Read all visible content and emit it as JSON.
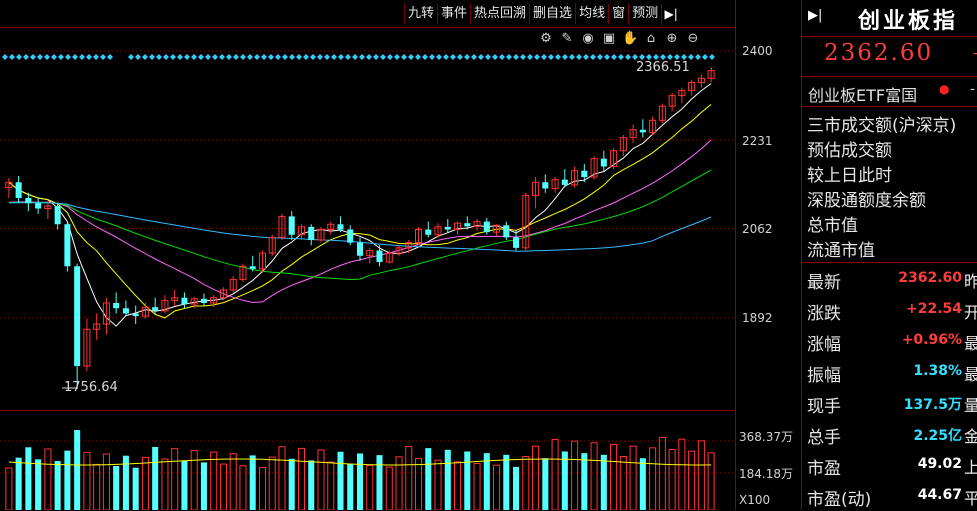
{
  "toolbar": {
    "buttons": [
      "九转",
      "事件",
      "热点回溯",
      "删自选",
      "均线",
      "窗",
      "预测"
    ],
    "collapse_icon": "collapse-arrow-icon"
  },
  "tools": [
    "gear-icon",
    "pen-icon",
    "eye-icon",
    "bag-icon",
    "hand-icon",
    "lock-icon",
    "zoom-in-icon",
    "zoom-out-icon"
  ],
  "axis": {
    "price_ticks": [
      "2400",
      "2231",
      "2062",
      "1892"
    ],
    "volume_ticks": [
      "368.37万",
      "184.18万"
    ],
    "volume_unit": "X100"
  },
  "annotations": {
    "high": "2366.51",
    "low": "1756.64"
  },
  "panel": {
    "title": "创业板指",
    "price": "2362.60",
    "price_sign": "+",
    "etf_label": "创业板ETF富国",
    "info_items": [
      "三市成交额(沪深京)",
      "预估成交额",
      "较上日此时",
      "深股通额度余额",
      "总市值",
      "流通市值"
    ],
    "rows": [
      {
        "label": "最新",
        "value": "2362.60",
        "tail": "昨",
        "color": "red"
      },
      {
        "label": "涨跌",
        "value": "+22.54",
        "tail": "开",
        "color": "red"
      },
      {
        "label": "涨幅",
        "value": "+0.96%",
        "tail": "最",
        "color": "red"
      },
      {
        "label": "振幅",
        "value": "1.38%",
        "tail": "最",
        "color": "cyan"
      },
      {
        "label": "现手",
        "value": "137.5万",
        "tail": "量",
        "color": "cyan"
      },
      {
        "label": "总手",
        "value": "2.25亿",
        "tail": "金",
        "color": "cyan"
      },
      {
        "label": "市盈",
        "value": "49.02",
        "tail": "上",
        "color": "white"
      },
      {
        "label": "市盈(动)",
        "value": "44.67",
        "tail": "平",
        "color": "white"
      }
    ]
  },
  "colors": {
    "up": "#ff3333",
    "down": "#54ffff",
    "ma5": "#ffffff",
    "ma10": "#ffff00",
    "ma20": "#ff66ff",
    "ma30": "#00dd00",
    "ma60": "#33bbff"
  },
  "chart_data": {
    "type": "candlestick",
    "price_range": [
      1720,
      2440
    ],
    "candles": [
      [
        2140,
        2158,
        2120,
        2150
      ],
      [
        2150,
        2162,
        2110,
        2120
      ],
      [
        2120,
        2130,
        2095,
        2110
      ],
      [
        2110,
        2120,
        2090,
        2100
      ],
      [
        2100,
        2115,
        2080,
        2105
      ],
      [
        2105,
        2110,
        2060,
        2070
      ],
      [
        2070,
        2075,
        1980,
        1990
      ],
      [
        1990,
        1995,
        1756.64,
        1800
      ],
      [
        1800,
        1890,
        1790,
        1870
      ],
      [
        1870,
        1900,
        1850,
        1880
      ],
      [
        1880,
        1930,
        1860,
        1920
      ],
      [
        1920,
        1940,
        1900,
        1910
      ],
      [
        1910,
        1925,
        1895,
        1900
      ],
      [
        1900,
        1915,
        1880,
        1895
      ],
      [
        1895,
        1920,
        1890,
        1912
      ],
      [
        1912,
        1930,
        1900,
        1905
      ],
      [
        1905,
        1935,
        1900,
        1925
      ],
      [
        1925,
        1945,
        1915,
        1930
      ],
      [
        1930,
        1940,
        1910,
        1918
      ],
      [
        1918,
        1932,
        1910,
        1928
      ],
      [
        1928,
        1938,
        1915,
        1920
      ],
      [
        1920,
        1935,
        1912,
        1930
      ],
      [
        1930,
        1950,
        1925,
        1945
      ],
      [
        1945,
        1972,
        1940,
        1965
      ],
      [
        1965,
        1995,
        1960,
        1990
      ],
      [
        1990,
        2010,
        1980,
        1985
      ],
      [
        1985,
        2020,
        1978,
        2015
      ],
      [
        2015,
        2050,
        2010,
        2045
      ],
      [
        2045,
        2090,
        2040,
        2085
      ],
      [
        2085,
        2095,
        2040,
        2050
      ],
      [
        2050,
        2070,
        2040,
        2065
      ],
      [
        2065,
        2070,
        2030,
        2040
      ],
      [
        2040,
        2065,
        2035,
        2060
      ],
      [
        2060,
        2075,
        2050,
        2070
      ],
      [
        2070,
        2085,
        2055,
        2060
      ],
      [
        2060,
        2068,
        2030,
        2035
      ],
      [
        2035,
        2045,
        2000,
        2010
      ],
      [
        2010,
        2025,
        1995,
        2020
      ],
      [
        2020,
        2030,
        1990,
        1998
      ],
      [
        1998,
        2020,
        1995,
        2015
      ],
      [
        2015,
        2030,
        2010,
        2025
      ],
      [
        2025,
        2040,
        2015,
        2035
      ],
      [
        2035,
        2065,
        2030,
        2060
      ],
      [
        2060,
        2075,
        2045,
        2050
      ],
      [
        2050,
        2072,
        2045,
        2065
      ],
      [
        2065,
        2080,
        2055,
        2060
      ],
      [
        2060,
        2075,
        2050,
        2072
      ],
      [
        2072,
        2085,
        2060,
        2066
      ],
      [
        2066,
        2080,
        2058,
        2075
      ],
      [
        2075,
        2082,
        2050,
        2055
      ],
      [
        2055,
        2070,
        2048,
        2068
      ],
      [
        2068,
        2075,
        2040,
        2045
      ],
      [
        2045,
        2058,
        2020,
        2025
      ],
      [
        2025,
        2130,
        2020,
        2125
      ],
      [
        2125,
        2160,
        2100,
        2150
      ],
      [
        2150,
        2165,
        2130,
        2138
      ],
      [
        2138,
        2160,
        2130,
        2155
      ],
      [
        2155,
        2175,
        2140,
        2145
      ],
      [
        2145,
        2180,
        2140,
        2172
      ],
      [
        2172,
        2185,
        2150,
        2160
      ],
      [
        2160,
        2200,
        2155,
        2195
      ],
      [
        2195,
        2210,
        2170,
        2180
      ],
      [
        2180,
        2215,
        2175,
        2210
      ],
      [
        2210,
        2240,
        2200,
        2235
      ],
      [
        2235,
        2260,
        2225,
        2250
      ],
      [
        2250,
        2270,
        2235,
        2245
      ],
      [
        2245,
        2275,
        2240,
        2268
      ],
      [
        2268,
        2300,
        2262,
        2295
      ],
      [
        2295,
        2320,
        2285,
        2315
      ],
      [
        2315,
        2330,
        2300,
        2325
      ],
      [
        2325,
        2345,
        2315,
        2340
      ],
      [
        2340,
        2355,
        2330,
        2348
      ],
      [
        2348,
        2366.51,
        2340,
        2362.6
      ]
    ],
    "volume_range": [
      0,
      400
    ]
  }
}
